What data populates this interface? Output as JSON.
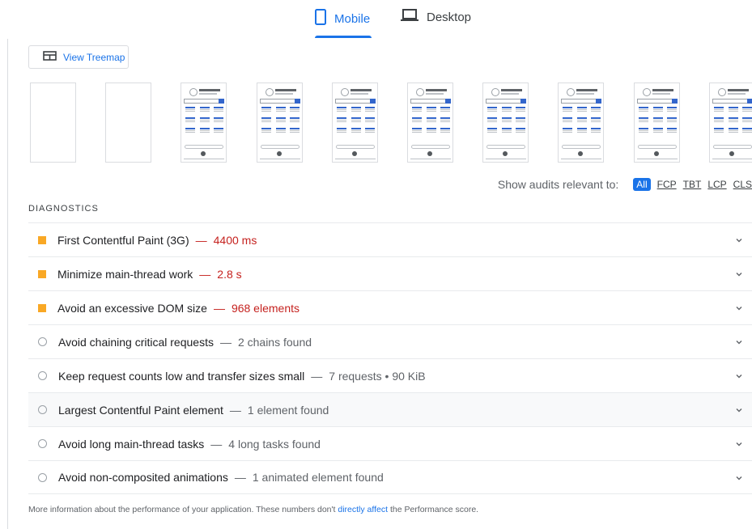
{
  "tabs": [
    {
      "label": "Mobile",
      "icon": "phone-icon",
      "active": true
    },
    {
      "label": "Desktop",
      "icon": "laptop-icon",
      "active": false
    }
  ],
  "treemap_button": {
    "label": "View Treemap",
    "icon": "treemap-icon"
  },
  "filmstrip": {
    "frames": [
      "blank",
      "blank",
      "page",
      "page",
      "page",
      "page",
      "page",
      "page",
      "page",
      "page"
    ]
  },
  "filter": {
    "label": "Show audits relevant to:",
    "options": [
      "All",
      "FCP",
      "TBT",
      "LCP",
      "CLS"
    ],
    "active": "All"
  },
  "diagnostics": {
    "title": "DIAGNOSTICS",
    "audits": [
      {
        "title": "First Contentful Paint (3G)",
        "separator": "—",
        "display": "4400 ms",
        "status": "warn"
      },
      {
        "title": "Minimize main-thread work",
        "separator": "—",
        "display": "2.8 s",
        "status": "warn"
      },
      {
        "title": "Avoid an excessive DOM size",
        "separator": "—",
        "display": "968 elements",
        "status": "warn"
      },
      {
        "title": "Avoid chaining critical requests",
        "separator": "—",
        "display": "2 chains found",
        "status": "info"
      },
      {
        "title": "Keep request counts low and transfer sizes small",
        "separator": "—",
        "display": "7 requests • 90 KiB",
        "status": "info"
      },
      {
        "title": "Largest Contentful Paint element",
        "separator": "—",
        "display": "1 element found",
        "status": "info"
      },
      {
        "title": "Avoid long main-thread tasks",
        "separator": "—",
        "display": "4 long tasks found",
        "status": "info"
      },
      {
        "title": "Avoid non-composited animations",
        "separator": "—",
        "display": "1 animated element found",
        "status": "info"
      }
    ]
  },
  "footer": {
    "text_before": "More information about the performance of your application. These numbers don't ",
    "link": "directly affect",
    "text_after": " the Performance score."
  },
  "colors": {
    "accent": "#1a73e8",
    "warn_square": "#f9a825",
    "warn_text": "#c5221f"
  }
}
